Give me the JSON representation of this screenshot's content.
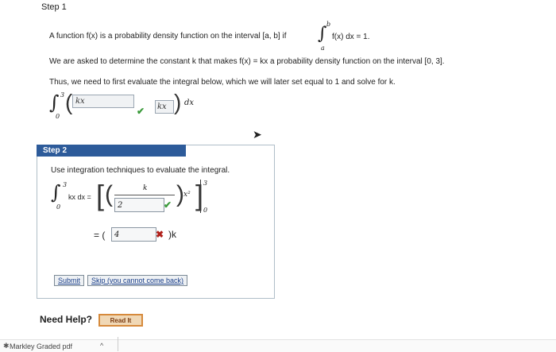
{
  "step1": {
    "title": "Step 1",
    "sentence1_prefix": "A function f(x) is a probability density function on the interval [a, b] if",
    "sentence1_integral": "∫",
    "integral_upper": "b",
    "integral_lower": "a",
    "sentence1_suffix": "f(x) dx = 1.",
    "sentence2": "We are asked to determine the constant k that makes f(x) = kx a probability density function on the interval [0, 3].",
    "sentence3": "Thus, we need to first evaluate the integral below, which we will later set equal to 1 and solve for k.",
    "expr": {
      "int_upper": "3",
      "int_lower": "0",
      "box1_value": "kx",
      "box2_value": "kx",
      "dx": "dx"
    }
  },
  "step2": {
    "title": "Step 2",
    "instruction": "Use integration techniques to evaluate the integral.",
    "lhs": "kx dx =",
    "int_upper": "3",
    "int_lower": "0",
    "frac_numerator": "k",
    "frac_denominator_value": "2",
    "power": "x²",
    "eval_upper": "3",
    "eval_lower": "0",
    "line2_prefix": "= (",
    "line2_value": "4",
    "line2_suffix": ")k",
    "submit_label": "Submit",
    "skip_label": "Skip (you cannot come back)"
  },
  "help": {
    "label": "Need Help?",
    "read_it": "Read It"
  },
  "footer": {
    "file_label": "Markley Graded pdf"
  },
  "colors": {
    "step2_header": "#2d5b9a",
    "check": "#3a9a3a",
    "cross": "#b0201a",
    "read_it_border": "#d68a3c"
  }
}
